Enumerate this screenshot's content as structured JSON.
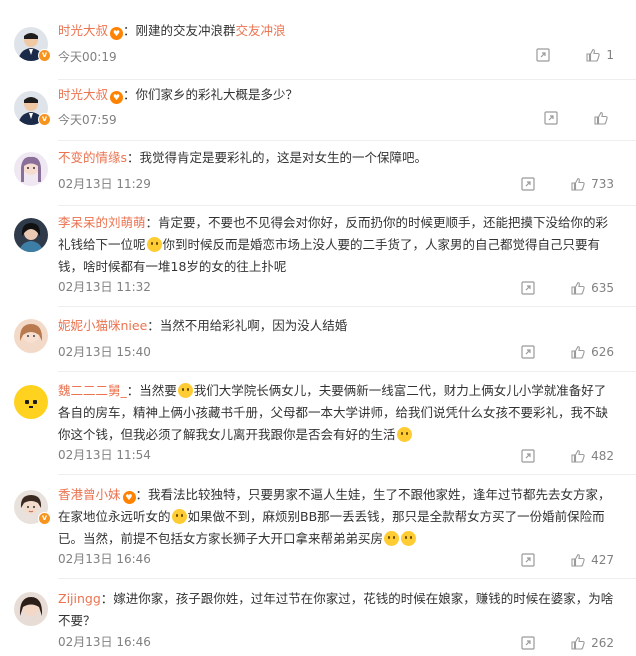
{
  "colors": {
    "username": "#eb7350",
    "text": "#333333",
    "meta": "#808080"
  },
  "comments": [
    {
      "user": "时光大叔",
      "text": "：刚建的交友冲浪群",
      "link": "交友冲浪",
      "time": "今天00:19",
      "likes": "1"
    },
    {
      "user": "时光大叔",
      "text": "：你们家乡的彩礼大概是多少？",
      "time": "今天07:59",
      "likes": ""
    },
    {
      "user": "不变的情缘s",
      "text": "：我觉得肯定是要彩礼的，这是对女生的一个保障吧。",
      "time": "02月13日 11:29",
      "likes": "733"
    },
    {
      "user": "李呆呆的刘萌萌",
      "text1": "：肯定要，不要也不见得会对你好，反而扔你的时候更顺手，还能把摸下没给你的彩礼钱给下一位呢",
      "text2": "你到时候反而是婚恋市场上没人要的二手货了，人家男的自己都觉得自己只要有钱，啥时候都有一堆18岁的女的往上扑呢",
      "time": "02月13日 11:32",
      "likes": "635"
    },
    {
      "user": "妮妮小猫咪niee",
      "text": "：当然不用给彩礼啊，因为没人结婚",
      "time": "02月13日 15:40",
      "likes": "626"
    },
    {
      "user": "魏二二二舅_",
      "text": "：当然要",
      "text2": "我们大学院长俩女儿，夫要俩新一线富二代，财力上俩女儿小学就准备好了各自的房车，精神上俩小孩藏书千册，父母都一本大学讲师，给我们说凭什么女孩不要彩礼，我不缺你这个钱，但我必须了解我女儿离开我跟你是否会有好的生活",
      "time": "02月13日 11:54",
      "likes": "482"
    },
    {
      "user": "香港曾小妹",
      "text": "：我看法比较独特，只要男家不逼人生娃，生了不跟他家姓，逢年过节都先去女方家，在家地位永远听女的",
      "text2": "如果做不到，麻烦别BB那一丢丢钱，那只是全款帮女方买了一份婚前保险而已。当然，前提不包括女方家长狮子大开口拿来帮弟弟买房",
      "time": "02月13日 16:46",
      "likes": "427"
    },
    {
      "user": "Zijingg",
      "text": "：嫁进你家，孩子跟你姓，过年过节在你家过，花钱的时候在娘家，赚钱的时候在婆家，为啥不要？",
      "time": "02月13日 16:46",
      "likes": "262"
    }
  ]
}
